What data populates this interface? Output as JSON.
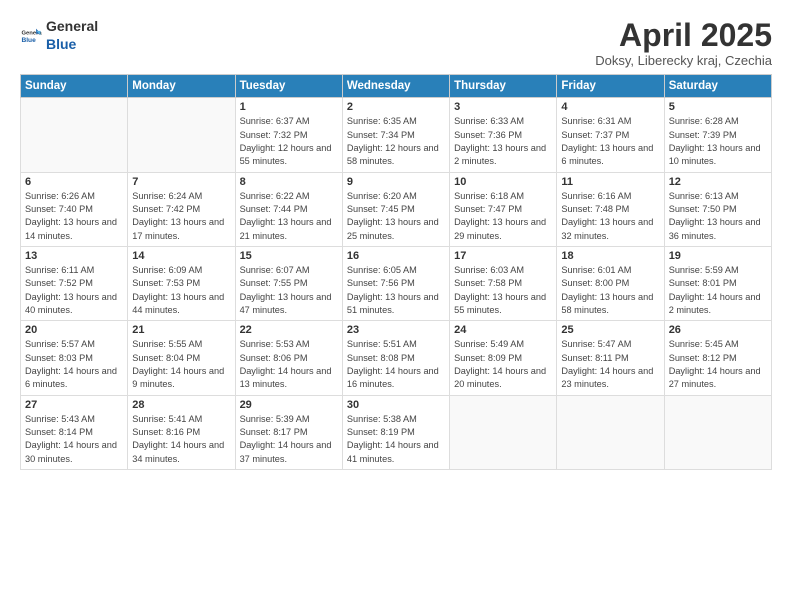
{
  "header": {
    "logo_general": "General",
    "logo_blue": "Blue",
    "title": "April 2025",
    "location": "Doksy, Liberecky kraj, Czechia"
  },
  "weekdays": [
    "Sunday",
    "Monday",
    "Tuesday",
    "Wednesday",
    "Thursday",
    "Friday",
    "Saturday"
  ],
  "weeks": [
    [
      {
        "day": "",
        "info": ""
      },
      {
        "day": "",
        "info": ""
      },
      {
        "day": "1",
        "info": "Sunrise: 6:37 AM\nSunset: 7:32 PM\nDaylight: 12 hours and 55 minutes."
      },
      {
        "day": "2",
        "info": "Sunrise: 6:35 AM\nSunset: 7:34 PM\nDaylight: 12 hours and 58 minutes."
      },
      {
        "day": "3",
        "info": "Sunrise: 6:33 AM\nSunset: 7:36 PM\nDaylight: 13 hours and 2 minutes."
      },
      {
        "day": "4",
        "info": "Sunrise: 6:31 AM\nSunset: 7:37 PM\nDaylight: 13 hours and 6 minutes."
      },
      {
        "day": "5",
        "info": "Sunrise: 6:28 AM\nSunset: 7:39 PM\nDaylight: 13 hours and 10 minutes."
      }
    ],
    [
      {
        "day": "6",
        "info": "Sunrise: 6:26 AM\nSunset: 7:40 PM\nDaylight: 13 hours and 14 minutes."
      },
      {
        "day": "7",
        "info": "Sunrise: 6:24 AM\nSunset: 7:42 PM\nDaylight: 13 hours and 17 minutes."
      },
      {
        "day": "8",
        "info": "Sunrise: 6:22 AM\nSunset: 7:44 PM\nDaylight: 13 hours and 21 minutes."
      },
      {
        "day": "9",
        "info": "Sunrise: 6:20 AM\nSunset: 7:45 PM\nDaylight: 13 hours and 25 minutes."
      },
      {
        "day": "10",
        "info": "Sunrise: 6:18 AM\nSunset: 7:47 PM\nDaylight: 13 hours and 29 minutes."
      },
      {
        "day": "11",
        "info": "Sunrise: 6:16 AM\nSunset: 7:48 PM\nDaylight: 13 hours and 32 minutes."
      },
      {
        "day": "12",
        "info": "Sunrise: 6:13 AM\nSunset: 7:50 PM\nDaylight: 13 hours and 36 minutes."
      }
    ],
    [
      {
        "day": "13",
        "info": "Sunrise: 6:11 AM\nSunset: 7:52 PM\nDaylight: 13 hours and 40 minutes."
      },
      {
        "day": "14",
        "info": "Sunrise: 6:09 AM\nSunset: 7:53 PM\nDaylight: 13 hours and 44 minutes."
      },
      {
        "day": "15",
        "info": "Sunrise: 6:07 AM\nSunset: 7:55 PM\nDaylight: 13 hours and 47 minutes."
      },
      {
        "day": "16",
        "info": "Sunrise: 6:05 AM\nSunset: 7:56 PM\nDaylight: 13 hours and 51 minutes."
      },
      {
        "day": "17",
        "info": "Sunrise: 6:03 AM\nSunset: 7:58 PM\nDaylight: 13 hours and 55 minutes."
      },
      {
        "day": "18",
        "info": "Sunrise: 6:01 AM\nSunset: 8:00 PM\nDaylight: 13 hours and 58 minutes."
      },
      {
        "day": "19",
        "info": "Sunrise: 5:59 AM\nSunset: 8:01 PM\nDaylight: 14 hours and 2 minutes."
      }
    ],
    [
      {
        "day": "20",
        "info": "Sunrise: 5:57 AM\nSunset: 8:03 PM\nDaylight: 14 hours and 6 minutes."
      },
      {
        "day": "21",
        "info": "Sunrise: 5:55 AM\nSunset: 8:04 PM\nDaylight: 14 hours and 9 minutes."
      },
      {
        "day": "22",
        "info": "Sunrise: 5:53 AM\nSunset: 8:06 PM\nDaylight: 14 hours and 13 minutes."
      },
      {
        "day": "23",
        "info": "Sunrise: 5:51 AM\nSunset: 8:08 PM\nDaylight: 14 hours and 16 minutes."
      },
      {
        "day": "24",
        "info": "Sunrise: 5:49 AM\nSunset: 8:09 PM\nDaylight: 14 hours and 20 minutes."
      },
      {
        "day": "25",
        "info": "Sunrise: 5:47 AM\nSunset: 8:11 PM\nDaylight: 14 hours and 23 minutes."
      },
      {
        "day": "26",
        "info": "Sunrise: 5:45 AM\nSunset: 8:12 PM\nDaylight: 14 hours and 27 minutes."
      }
    ],
    [
      {
        "day": "27",
        "info": "Sunrise: 5:43 AM\nSunset: 8:14 PM\nDaylight: 14 hours and 30 minutes."
      },
      {
        "day": "28",
        "info": "Sunrise: 5:41 AM\nSunset: 8:16 PM\nDaylight: 14 hours and 34 minutes."
      },
      {
        "day": "29",
        "info": "Sunrise: 5:39 AM\nSunset: 8:17 PM\nDaylight: 14 hours and 37 minutes."
      },
      {
        "day": "30",
        "info": "Sunrise: 5:38 AM\nSunset: 8:19 PM\nDaylight: 14 hours and 41 minutes."
      },
      {
        "day": "",
        "info": ""
      },
      {
        "day": "",
        "info": ""
      },
      {
        "day": "",
        "info": ""
      }
    ]
  ]
}
